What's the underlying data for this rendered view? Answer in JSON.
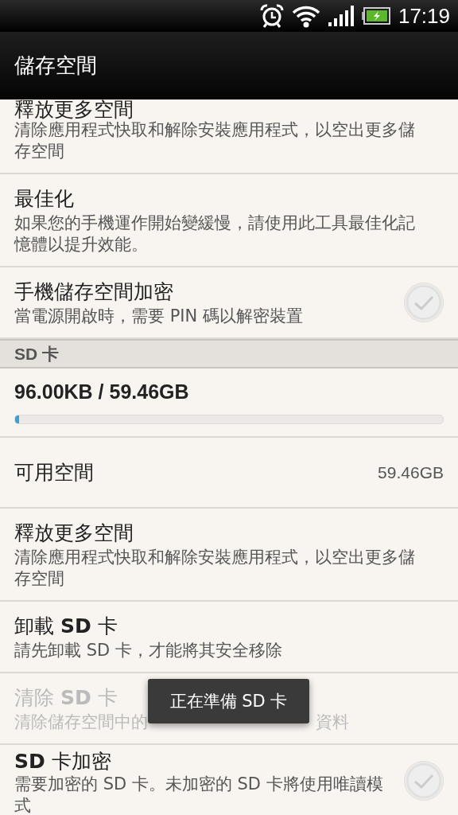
{
  "status_bar": {
    "time": "17:19"
  },
  "action_bar": {
    "title": "儲存空間"
  },
  "phone_items": [
    {
      "kind": "text",
      "title": "釋放更多空間",
      "summary": "清除應用程式快取和解除安裝應用程式，以空出更多儲存空間",
      "disabled": false
    },
    {
      "kind": "text",
      "title": "最佳化",
      "summary": "如果您的手機運作開始變緩慢，請使用此工具最佳化記憶體以提升效能。",
      "disabled": false
    },
    {
      "kind": "checkbox",
      "title": "手機儲存空間加密",
      "summary": "當電源開啟時，需要 PIN 碼以解密裝置",
      "disabled": false,
      "checked": false
    }
  ],
  "sd_section": {
    "header": "SD 卡",
    "usage": "96.00KB / 59.46GB",
    "level": 0.01,
    "available_label": "可用空間",
    "available_value": "59.46GB",
    "items": [
      {
        "kind": "text",
        "title": "釋放更多空間",
        "summary": "清除應用程式快取和解除安裝應用程式，以空出更多儲存空間",
        "disabled": false
      },
      {
        "kind": "text",
        "title": "卸載 **SD** 卡",
        "summary": "請先卸載 SD 卡，才能將其安全移除",
        "disabled": false
      },
      {
        "kind": "text",
        "title": "清除 **SD** 卡",
        "summary": "清除儲存空間中的",
        "summary_tail": "資料",
        "disabled": true
      },
      {
        "kind": "checkbox",
        "title": "**SD** 卡加密",
        "summary": "需要加密的 SD 卡。未加密的 SD 卡將使用唯讀模式",
        "disabled": false,
        "checked": false
      }
    ]
  },
  "toast": {
    "text": "正在準備 SD 卡"
  }
}
